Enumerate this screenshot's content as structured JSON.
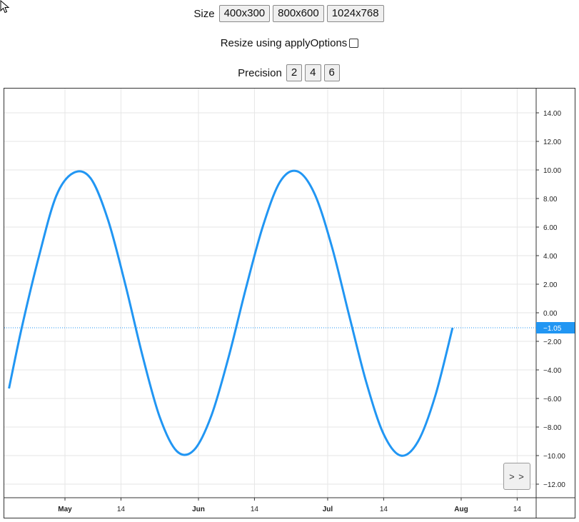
{
  "controls": {
    "size_label": "Size",
    "size_buttons": [
      "400x300",
      "800x600",
      "1024x768"
    ],
    "resize_label": "Resize using applyOptions",
    "precision_label": "Precision",
    "precision_buttons": [
      "2",
      "4",
      "6"
    ]
  },
  "nav_button_label": "> >",
  "colors": {
    "line": "#2196f3",
    "grid": "#e6e6e6",
    "price_label_bg": "#2196f3"
  },
  "chart_data": {
    "type": "line",
    "y_axis_position": "right",
    "ylim": [
      -13,
      16
    ],
    "y_ticks": [
      "14.00",
      "12.00",
      "10.00",
      "8.00",
      "6.00",
      "4.00",
      "2.00",
      "0.00",
      "-2.00",
      "-4.00",
      "-6.00",
      "-8.00",
      "-10.00",
      "-12.00"
    ],
    "x_ticks": [
      {
        "label": "May",
        "date": "2018-05-01",
        "major": true
      },
      {
        "label": "14",
        "date": "2018-05-14",
        "major": false
      },
      {
        "label": "Jun",
        "date": "2018-06-01",
        "major": true
      },
      {
        "label": "14",
        "date": "2018-06-14",
        "major": false
      },
      {
        "label": "Jul",
        "date": "2018-07-01",
        "major": true
      },
      {
        "label": "14",
        "date": "2018-07-14",
        "major": false
      },
      {
        "label": "Aug",
        "date": "2018-08-01",
        "major": true
      },
      {
        "label": "14",
        "date": "2018-08-14",
        "major": false
      }
    ],
    "grid": true,
    "last_value_label": "−1.05",
    "series": [
      {
        "values": [
          {
            "x": "2018-04-18",
            "y": -5.3
          },
          {
            "x": "2018-04-21",
            "y": -1.0
          },
          {
            "x": "2018-04-25",
            "y": 4.0
          },
          {
            "x": "2018-04-29",
            "y": 8.2
          },
          {
            "x": "2018-05-03",
            "y": 9.8
          },
          {
            "x": "2018-05-07",
            "y": 9.4
          },
          {
            "x": "2018-05-11",
            "y": 6.5
          },
          {
            "x": "2018-05-15",
            "y": 2.0
          },
          {
            "x": "2018-05-19",
            "y": -3.0
          },
          {
            "x": "2018-05-23",
            "y": -7.3
          },
          {
            "x": "2018-05-27",
            "y": -9.7
          },
          {
            "x": "2018-05-31",
            "y": -9.6
          },
          {
            "x": "2018-06-04",
            "y": -7.2
          },
          {
            "x": "2018-06-08",
            "y": -3.1
          },
          {
            "x": "2018-06-12",
            "y": 1.7
          },
          {
            "x": "2018-06-16",
            "y": 6.1
          },
          {
            "x": "2018-06-20",
            "y": 9.2
          },
          {
            "x": "2018-06-24",
            "y": 9.9
          },
          {
            "x": "2018-06-28",
            "y": 8.3
          },
          {
            "x": "2018-07-02",
            "y": 4.6
          },
          {
            "x": "2018-07-06",
            "y": -0.2
          },
          {
            "x": "2018-07-10",
            "y": -4.9
          },
          {
            "x": "2018-07-14",
            "y": -8.5
          },
          {
            "x": "2018-07-18",
            "y": -10.0
          },
          {
            "x": "2018-07-22",
            "y": -9.0
          },
          {
            "x": "2018-07-26",
            "y": -5.8
          },
          {
            "x": "2018-07-30",
            "y": -1.05
          }
        ]
      }
    ]
  }
}
